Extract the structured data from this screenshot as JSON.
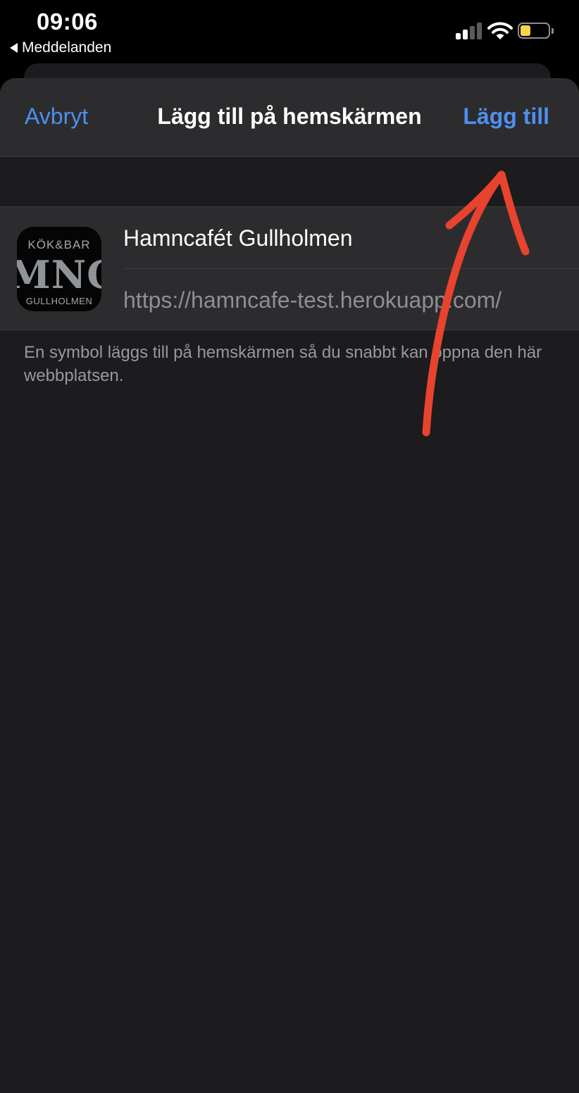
{
  "status_bar": {
    "time": "09:06",
    "back_label": "Meddelanden",
    "battery_color": "#f7d64a"
  },
  "nav": {
    "cancel_label": "Avbryt",
    "title": "Lägg till på hemskärmen",
    "add_label": "Lägg till",
    "accent_color": "#4f8ff0"
  },
  "shortcut": {
    "icon": {
      "top_text": "KÖK&BAR",
      "main_text": "MNCA",
      "bottom_text": "GULLHOLMEN"
    },
    "name": "Hamncafét Gullholmen",
    "url": "https://hamncafe-test.herokuapp.com/"
  },
  "footer_note": "En symbol läggs till på hemskärmen så du snabbt kan öppna den här webbplatsen.",
  "annotation": {
    "arrow_color": "#e8432e"
  }
}
